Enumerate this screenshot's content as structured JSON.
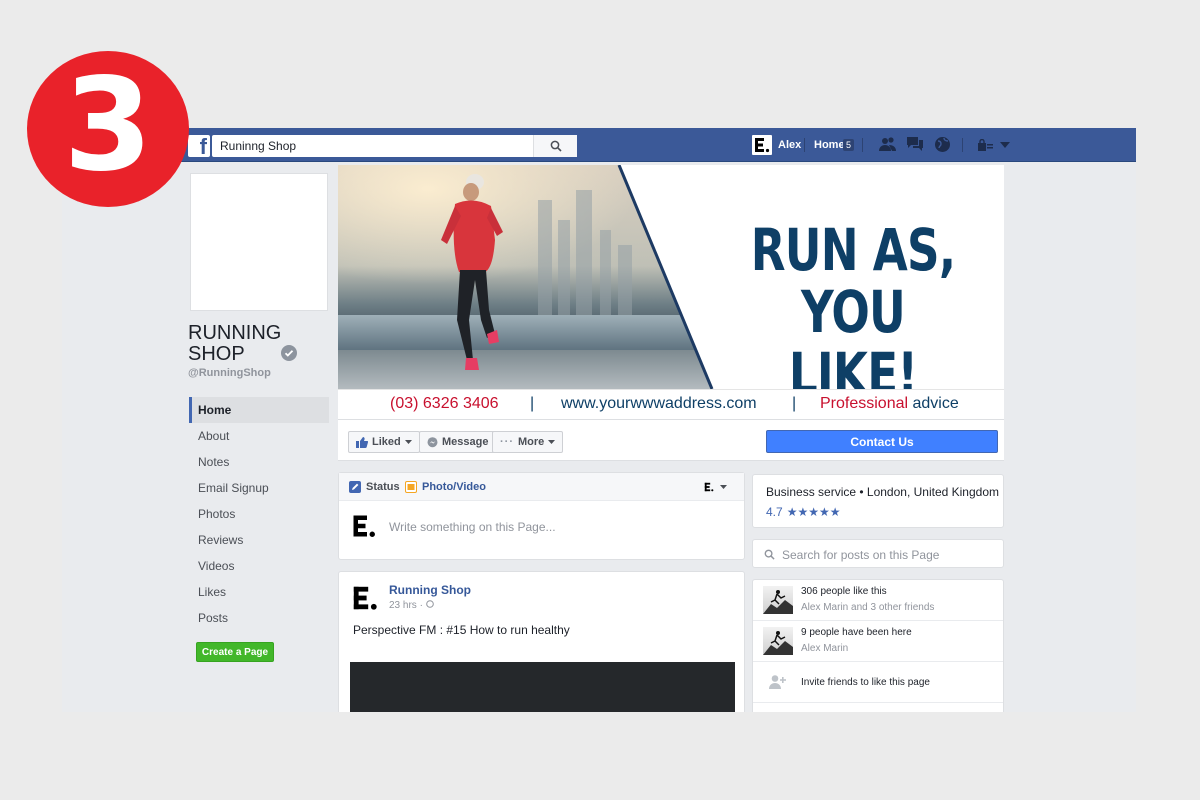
{
  "badge": {
    "number": "3"
  },
  "topbar": {
    "search_value": "Runinng Shop",
    "user_name": "Alex",
    "home_label": "Home",
    "home_count": "5",
    "brand_color": "#3b5998"
  },
  "page": {
    "name": "RUNNING SHOP",
    "handle": "@RunningShop"
  },
  "sidebar": {
    "items": [
      {
        "label": "Home",
        "active": true
      },
      {
        "label": "About"
      },
      {
        "label": "Notes"
      },
      {
        "label": "Email Signup"
      },
      {
        "label": "Photos"
      },
      {
        "label": "Reviews"
      },
      {
        "label": "Videos"
      },
      {
        "label": "Likes"
      },
      {
        "label": "Posts"
      }
    ],
    "create_page_label": "Create a Page"
  },
  "cover": {
    "headline_line1": "RUN AS,",
    "headline_line2": "YOU LIKE!",
    "phone": "(03) 6326 3406",
    "url_prefix": "www.",
    "url_domain": "yourwwwaddress",
    "url_suffix": ".com",
    "tag_red": "Professional",
    "tag_blue": "advice",
    "separator": "|",
    "accent_red": "#c8102e",
    "accent_blue": "#0e3f66"
  },
  "actions": {
    "liked": "Liked",
    "message": "Message",
    "more": "More",
    "contact_us": "Contact Us"
  },
  "composer": {
    "status_tab": "Status",
    "photo_tab": "Photo/Video",
    "placeholder": "Write something on this Page..."
  },
  "post": {
    "author": "Running Shop",
    "time": "23 hrs",
    "text": "Perspective FM : #15 How to run healthy"
  },
  "right": {
    "business_line": "Business service • London, United Kingdom",
    "rating": "4.7",
    "stars": "★★★★★",
    "search_placeholder": "Search for posts on this Page",
    "likes_title": "306 people like this",
    "likes_sub": "Alex Marin and 3 other friends",
    "been_title": "9 people have been here",
    "been_sub": "Alex Marin",
    "invite": "Invite friends to like this page"
  }
}
